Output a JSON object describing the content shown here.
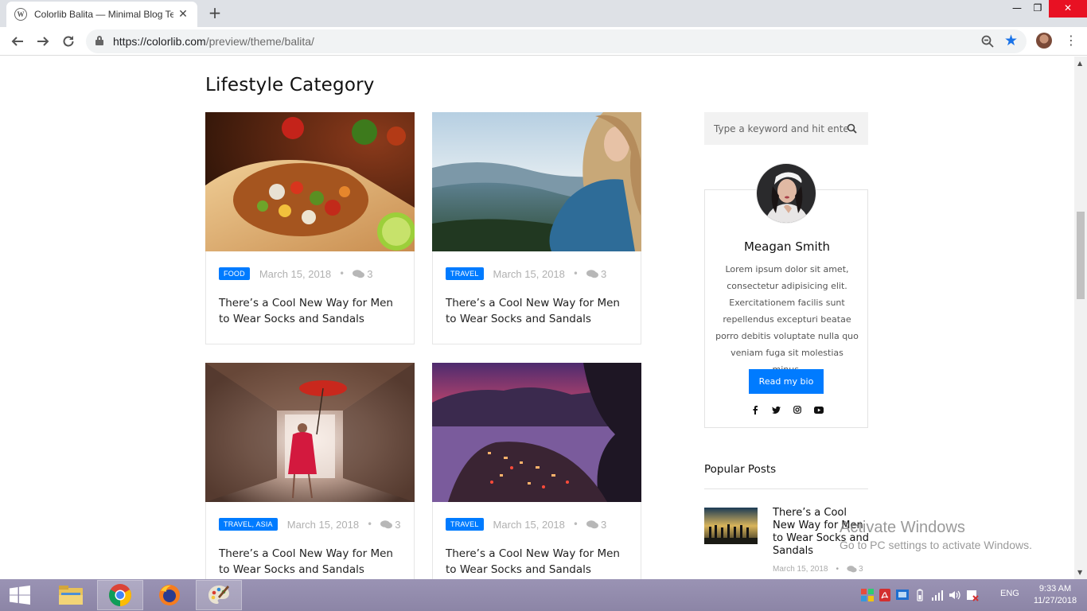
{
  "browser": {
    "tab_title": "Colorlib Balita — Minimal Blog Te",
    "new_tab": "+",
    "close_tab": "✕",
    "url_host": "https://colorlib.com",
    "url_path": "/preview/theme/balita/",
    "window_min": "—",
    "window_max": "❐",
    "window_close": "✕"
  },
  "page": {
    "section_title": "Lifestyle Category",
    "posts": [
      {
        "badge": "FOOD",
        "date": "March 15, 2018",
        "comments": "3",
        "title": "There’s a Cool New Way for Men to Wear Socks and Sandals"
      },
      {
        "badge": "TRAVEL",
        "date": "March 15, 2018",
        "comments": "3",
        "title": "There’s a Cool New Way for Men to Wear Socks and Sandals"
      },
      {
        "badge": "TRAVEL, ASIA",
        "date": "March 15, 2018",
        "comments": "3",
        "title": "There’s a Cool New Way for Men to Wear Socks and Sandals"
      },
      {
        "badge": "TRAVEL",
        "date": "March 15, 2018",
        "comments": "3",
        "title": "There’s a Cool New Way for Men to Wear Socks and Sandals"
      }
    ],
    "separator": "•"
  },
  "sidebar": {
    "search_placeholder": "Type a keyword and hit enter",
    "bio_name": "Meagan Smith",
    "bio_text": "Lorem ipsum dolor sit amet, consectetur adipisicing elit. Exercitationem facilis sunt repellendus excepturi beatae porro debitis voluptate nulla quo veniam fuga sit molestias minus.",
    "bio_button": "Read my bio",
    "popular_title": "Popular Posts",
    "popular_post": {
      "title": "There’s a Cool New Way for Men to Wear Socks and Sandals",
      "date": "March 15, 2018",
      "comments": "3"
    }
  },
  "watermark": {
    "line1": "Activate Windows",
    "line2": "Go to PC settings to activate Windows."
  },
  "taskbar": {
    "language": "ENG",
    "time": "9:33 AM",
    "date": "11/27/2018"
  },
  "colors": {
    "accent": "#007bff",
    "taskbar": "#8c85a6",
    "close_button": "#e81123"
  }
}
